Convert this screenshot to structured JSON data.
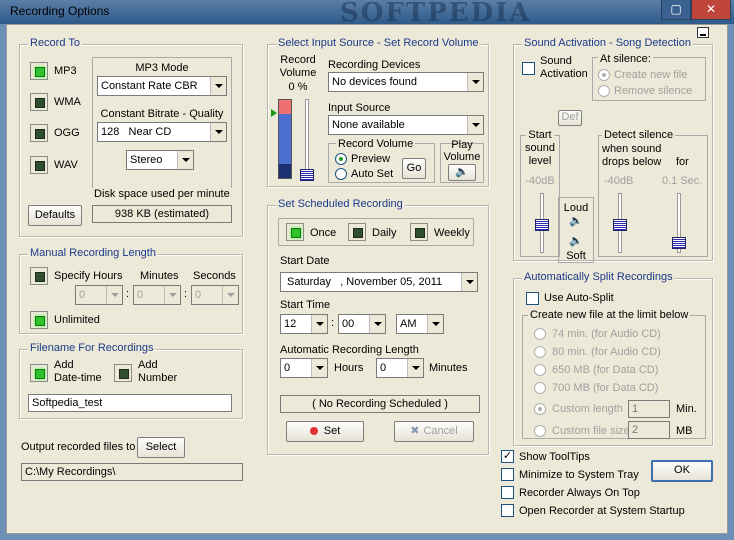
{
  "window": {
    "title": "Recording Options",
    "watermark": "SOFTPEDIA"
  },
  "record_to": {
    "title": "Record To",
    "formats": [
      "MP3",
      "WMA",
      "OGG",
      "WAV"
    ],
    "mp3_mode_label": "MP3 Mode",
    "mp3_mode_value": "Constant Rate CBR",
    "bitrate_label": "Constant Bitrate - Quality",
    "bitrate_value": "128",
    "bitrate_quality": "Near CD",
    "channels_value": "Stereo",
    "disk_label": "Disk space used per minute",
    "disk_value": "938  KB (estimated)",
    "defaults_button": "Defaults"
  },
  "manual_length": {
    "title": "Manual Recording Length",
    "specify_hours": "Specify Hours",
    "minutes": "Minutes",
    "seconds": "Seconds",
    "hours_value": "0",
    "minutes_value": "0",
    "seconds_value": "0",
    "colon": ":",
    "unlimited": "Unlimited"
  },
  "filename": {
    "title": "Filename For Recordings",
    "add_datetime_1": "Add",
    "add_datetime_2": "Date-time",
    "add_number_1": "Add",
    "add_number_2": "Number",
    "value": "Softpedia_test"
  },
  "output": {
    "label": "Output recorded files to",
    "select_button": "Select",
    "path": "C:\\My Recordings\\"
  },
  "input_source": {
    "title": "Select Input Source - Set Record Volume",
    "record_volume_1": "Record",
    "record_volume_2": "Volume",
    "volume_pct": "0  %",
    "devices_label": "Recording Devices",
    "devices_value": "No devices found",
    "source_label": "Input Source",
    "source_value": "None available",
    "rec_volume_label": "Record Volume",
    "preview": "Preview",
    "auto_set": "Auto Set",
    "go_button": "Go",
    "play_volume_1": "Play",
    "play_volume_2": "Volume"
  },
  "scheduled": {
    "title": "Set Scheduled Recording",
    "once": "Once",
    "daily": "Daily",
    "weekly": "Weekly",
    "start_date_label": "Start Date",
    "start_date_value": "Saturday   , November 05, 2011",
    "start_time_label": "Start Time",
    "hour_value": "12",
    "minute_value": "00",
    "ampm_value": "AM",
    "colon": ":",
    "auto_length_label": "Automatic Recording Length",
    "hours_value": "0",
    "hours_label": "Hours",
    "minutes_value": "0",
    "minutes_label": "Minutes",
    "status": "( No Recording Scheduled )",
    "set_button": "Set",
    "cancel_button": "Cancel"
  },
  "sound_activation": {
    "title": "Sound Activation - Song Detection",
    "sound_activation_1": "Sound",
    "sound_activation_2": "Activation",
    "at_silence_label": "At silence:",
    "create_new_file": "Create new file",
    "remove_silence": "Remove silence",
    "def_button": "Def",
    "start_1": "Start",
    "start_2": "sound",
    "start_3": "level",
    "start_db": "-40dB",
    "loud": "Loud",
    "soft": "Soft",
    "detect_label": "Detect silence",
    "when_sound_1": "when sound",
    "when_sound_2": "drops below",
    "for_label": "for",
    "detect_db": "-40dB",
    "detect_sec": "0.1  Sec."
  },
  "auto_split": {
    "title": "Automatically Split Recordings",
    "use_auto_split": "Use Auto-Split",
    "create_label": "Create new file at the limit below",
    "options": [
      "74 min.  (for Audio CD)",
      "80 min.  (for Audio CD)",
      "650 MB  (for Data CD)",
      "700 MB  (for Data CD)"
    ],
    "custom_length": "Custom length",
    "custom_length_value": "1",
    "custom_length_unit": "Min.",
    "custom_size": "Custom file size",
    "custom_size_value": "2",
    "custom_size_unit": "MB"
  },
  "options": {
    "show_tooltips": "Show ToolTips",
    "minimize_tray": "Minimize to System Tray",
    "always_on_top": "Recorder Always On Top",
    "open_startup": "Open Recorder at System Startup",
    "ok_button": "OK",
    "check_mark": "✓"
  },
  "colors": {
    "accent": "#1b3a8a",
    "led_on": "#2ec22e",
    "meter_red": "#f07070"
  }
}
